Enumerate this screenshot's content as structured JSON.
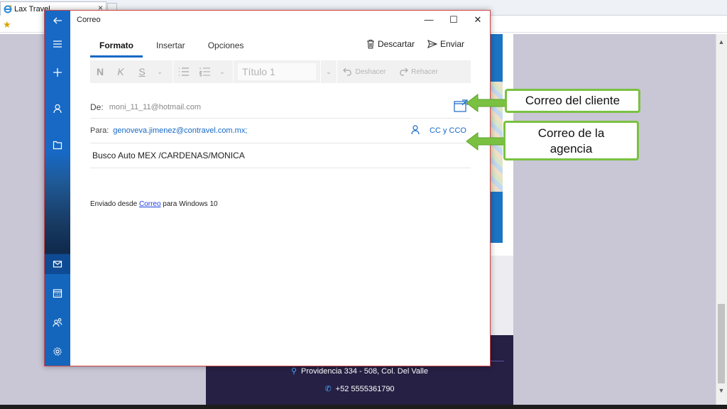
{
  "browser": {
    "tab_title": "Lax Travel",
    "tab_close": "×"
  },
  "website": {
    "address": "Providencia 334 - 508, Col. Del Valle",
    "phone": "+52 5555361790"
  },
  "mail": {
    "window_title": "Correo",
    "controls": {
      "minimize": "—",
      "maximize": "☐",
      "close": "✕"
    },
    "tabs": [
      {
        "label": "Formato",
        "active": true
      },
      {
        "label": "Insertar",
        "active": false
      },
      {
        "label": "Opciones",
        "active": false
      }
    ],
    "actions": {
      "discard": "Descartar",
      "send": "Enviar"
    },
    "toolbar": {
      "bold": "N",
      "italic": "K",
      "underline": "S",
      "style": "Título 1",
      "undo": "Deshacer",
      "redo": "Rehacer"
    },
    "from_label": "De:",
    "from_value": "moni_11_11@hotmail.com",
    "to_label": "Para:",
    "to_value": "genoveva.jimenez@contravel.com.mx;",
    "cc_label": "CC y CCO",
    "subject": "Busco Auto MEX /CARDENAS/MONICA",
    "body": {
      "prefix": "Enviado desde ",
      "link": "Correo",
      "suffix": " para Windows 10"
    }
  },
  "callouts": {
    "client": "Correo del cliente",
    "agency_line1": "Correo de la",
    "agency_line2": "agencia"
  },
  "colors": {
    "accent": "#1769c5",
    "callout_border": "#7ac142",
    "window_border": "#d04545",
    "footer": "#262044"
  }
}
